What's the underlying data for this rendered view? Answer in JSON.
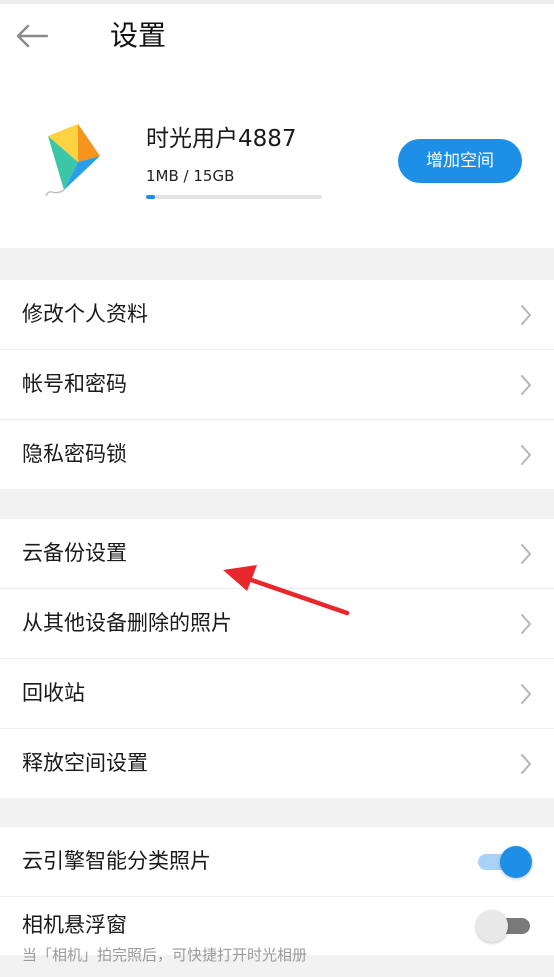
{
  "header": {
    "title": "设置"
  },
  "profile": {
    "user_name": "时光用户4887",
    "storage_text": "1MB / 15GB",
    "storage_used_fraction": 0.05,
    "add_space_label": "增加空间"
  },
  "group_account": {
    "items": [
      {
        "label": "修改个人资料"
      },
      {
        "label": "帐号和密码"
      },
      {
        "label": "隐私密码锁"
      }
    ]
  },
  "group_cloud": {
    "items": [
      {
        "label": "云备份设置"
      },
      {
        "label": "从其他设备删除的照片"
      },
      {
        "label": "回收站"
      },
      {
        "label": "释放空间设置"
      }
    ]
  },
  "group_features": {
    "smart_classify": {
      "label": "云引擎智能分类照片",
      "enabled": true
    },
    "camera_float": {
      "label": "相机悬浮窗",
      "description": "当「相机」拍完照后，可快捷打开时光相册",
      "enabled": false
    }
  },
  "colors": {
    "accent": "#1e8fe6",
    "annotation_arrow": "#e8262b"
  },
  "icons": {
    "back": "back-arrow-icon",
    "chevron": "chevron-right-icon",
    "logo": "kite-logo-icon"
  }
}
